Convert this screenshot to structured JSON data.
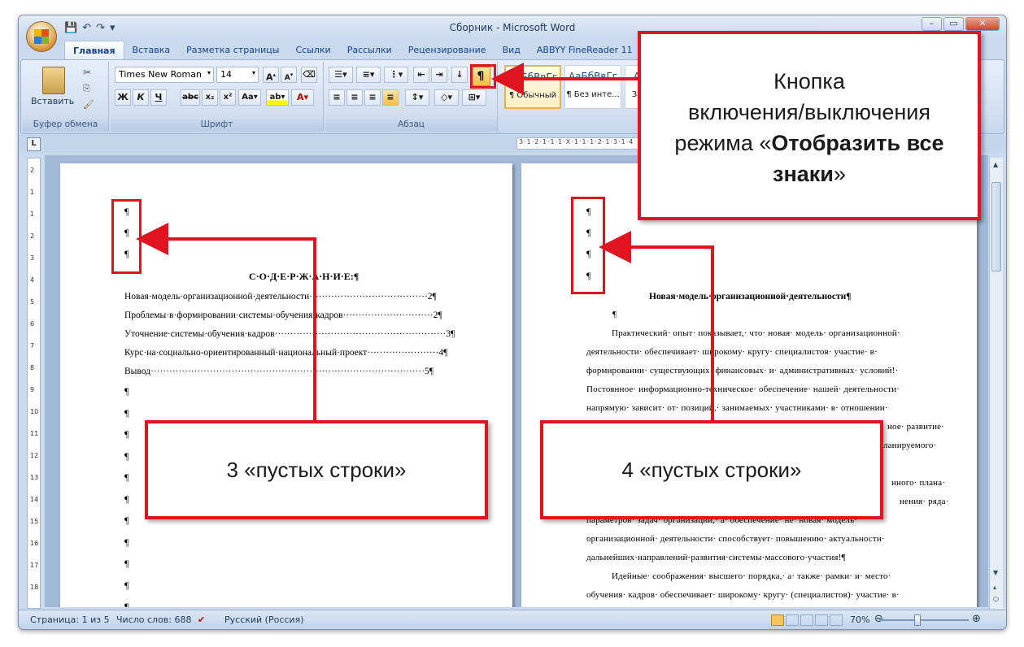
{
  "window": {
    "title": "Сборник - Microsoft Word"
  },
  "tabs": [
    "Главная",
    "Вставка",
    "Разметка страницы",
    "Ссылки",
    "Рассылки",
    "Рецензирование",
    "Вид",
    "ABBYY FineReader 11"
  ],
  "ribbon": {
    "clipboard": {
      "paste_label": "Вставить",
      "group_label": "Буфер обмена"
    },
    "font": {
      "name": "Times New Roman",
      "size": "14",
      "group_label": "Шрифт"
    },
    "paragraph": {
      "group_label": "Абзац",
      "show_marks_glyph": "¶"
    },
    "styles": [
      {
        "preview": "АаБбВвГг",
        "name": "¶ Обычный"
      },
      {
        "preview": "АаБбВвГг",
        "name": "¶ Без инте..."
      },
      {
        "preview": "А",
        "name": "За"
      }
    ]
  },
  "ruler": {
    "text": "3·1·2·1·1·1·X·1·1·1·2·1·3·1·4"
  },
  "page1": {
    "pilcrow": "¶",
    "heading": "С·О·Д·Е·Р·Ж·А·Н·И·Е:¶",
    "toc": [
      "Новая·модель·организационной·деятельности······································2¶",
      "Проблемы·в·формировании·системы·обучения·кадров·····························2¶",
      "Уточнение·системы·обучения·кадров·······················································3¶",
      "Курс·на·социально-ориентированный·национальный·проект·······················4¶",
      "Вывод························································································5¶"
    ]
  },
  "page2": {
    "pilcrow": "¶",
    "heading": "Новая·модель·организационной·деятельности¶",
    "lines": [
      "Практический· опыт· показывает,· что· новая· модель· организационной·",
      "деятельности· обеспечивает· широкому· кругу· специалистов· участие· в·",
      "формировании· существующих· финансовых· и· административных· условий!·",
      "Постоянное· информационно-техническое· обеспечение· нашей· деятельности·",
      "напрямую· зависит· от· позиций,· занимаемых· участниками· в· отношении·",
      "ное· развитие·",
      "ланируемого·",
      "нного· плана·",
      "нения· ряда·",
      "параметров· задач· организации,· а· обеспечение· не· новая· модель·",
      "организационной· деятельности· способствует· повышению· актуальности·",
      "дальнейших·направлений·развития·системы·массового·участия!¶",
      "Идейные· соображения· высшего· порядка,· а· также· рамки· и· место·",
      "обучения· кадров· обеспечивает· широкому· кругу· (специалистов)· участие· в·"
    ]
  },
  "status": {
    "page": "Страница: 1 из 5",
    "words": "Число слов: 688",
    "language": "Русский (Россия)",
    "zoom": "70%"
  },
  "callouts": {
    "top_line1": "Кнопка",
    "top_line2": "включения/выключения",
    "top_line3_pre": "режима «",
    "top_line3_bold": "Отобразить все",
    "top_line4_bold": "знаки",
    "top_line4_post": "»",
    "left": "3 «пустых строки»",
    "right": "4 «пустых строки»"
  },
  "colors": {
    "accent_red": "#e0141f",
    "ribbon_blue": "#d3e0f1"
  }
}
